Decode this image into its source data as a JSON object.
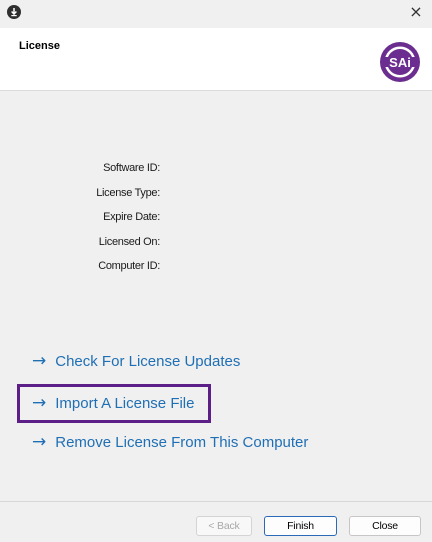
{
  "window": {
    "close_glyph": "×"
  },
  "header": {
    "title": "License",
    "logo_text": "SAi"
  },
  "info": {
    "fields": [
      {
        "label": "Software ID:"
      },
      {
        "label": "License Type:"
      },
      {
        "label": "Expire Date:"
      },
      {
        "label": "Licensed On:"
      },
      {
        "label": "Computer ID:"
      }
    ]
  },
  "actions": {
    "check_updates": "Check For License Updates",
    "import_file": "Import A License File",
    "remove_license": "Remove License From This Computer",
    "arrow": "→"
  },
  "footer": {
    "back": "< Back",
    "finish": "Finish",
    "close": "Close"
  },
  "colors": {
    "link": "#1f6fb5",
    "highlight": "#5c1f87",
    "brand": "#6b2d8f"
  }
}
